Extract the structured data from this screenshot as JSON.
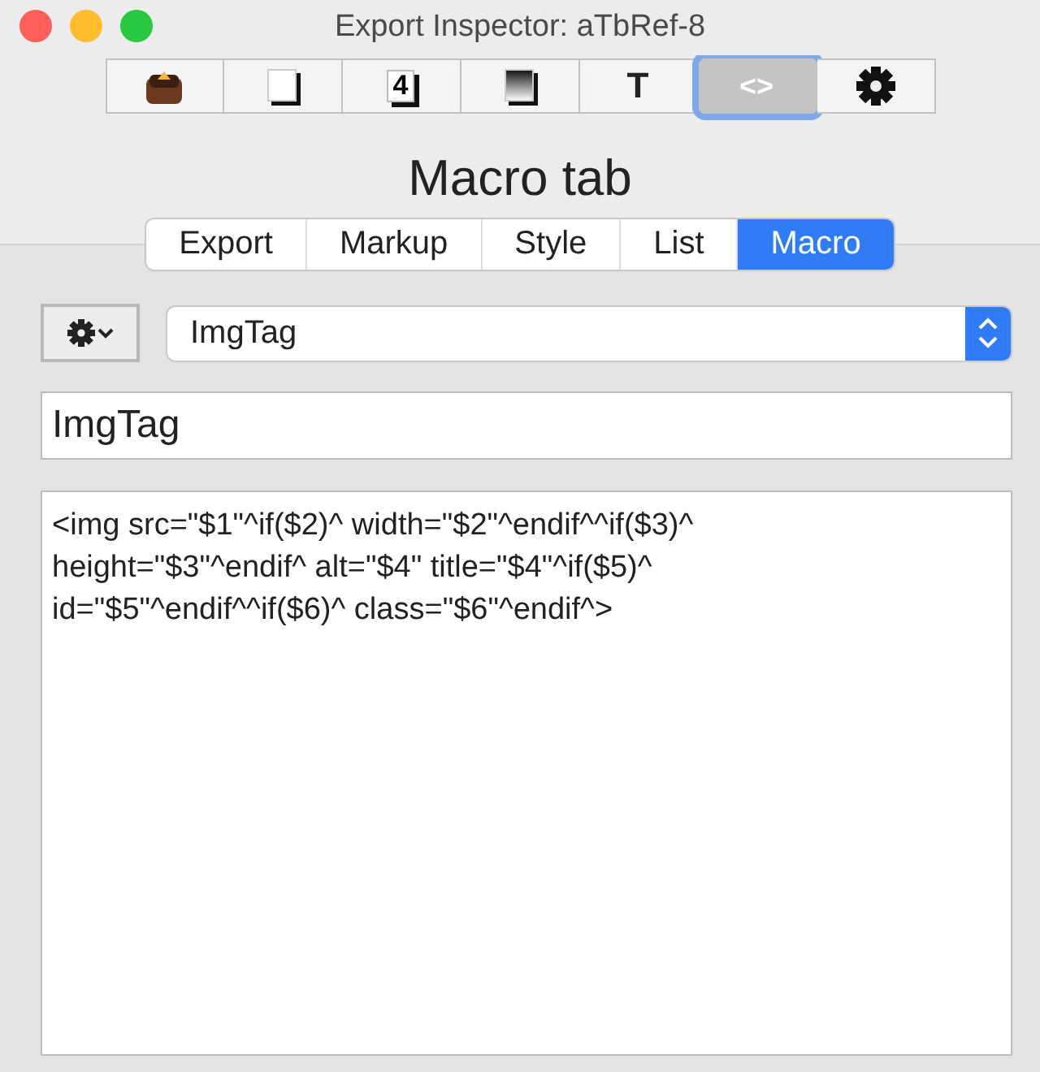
{
  "window": {
    "title": "Export Inspector: aTbRef-8"
  },
  "toolbar": [
    {
      "kind": "box",
      "selected": false
    },
    {
      "kind": "page",
      "selected": false
    },
    {
      "kind": "digit",
      "glyph": "4",
      "selected": false
    },
    {
      "kind": "gradient",
      "selected": false
    },
    {
      "kind": "letter",
      "glyph": "T",
      "selected": false
    },
    {
      "kind": "letter",
      "glyph": "<>",
      "selected": true
    },
    {
      "kind": "gear",
      "selected": false
    }
  ],
  "heading": "Macro tab",
  "tabs": [
    {
      "label": "Export",
      "selected": false
    },
    {
      "label": "Markup",
      "selected": false
    },
    {
      "label": "Style",
      "selected": false
    },
    {
      "label": "List",
      "selected": false
    },
    {
      "label": "Macro",
      "selected": true
    }
  ],
  "macro_popup": {
    "value": "ImgTag"
  },
  "name_field": {
    "value": "ImgTag"
  },
  "code_lines": [
    "<img src=\"$1\"^if($2)^ width=\"$2\"^endif^^if($3)^",
    "height=\"$3\"^endif^ alt=\"$4\" title=\"$4\"^if($5)^",
    "id=\"$5\"^endif^^if($6)^ class=\"$6\"^endif^>"
  ]
}
